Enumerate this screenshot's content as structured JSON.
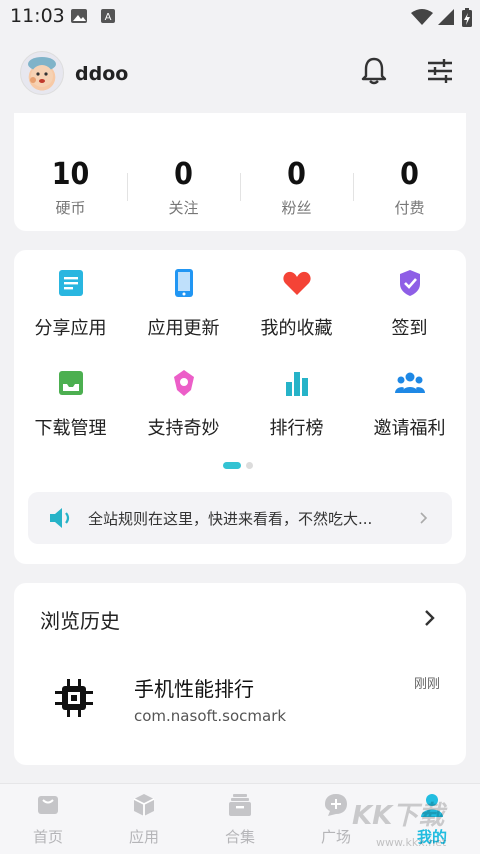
{
  "status": {
    "time": "11:03"
  },
  "profile": {
    "username": "ddoo"
  },
  "stats": [
    {
      "value": "10",
      "label": "硬币"
    },
    {
      "value": "0",
      "label": "关注"
    },
    {
      "value": "0",
      "label": "粉丝"
    },
    {
      "value": "0",
      "label": "付费"
    }
  ],
  "grid": [
    {
      "label": "分享应用",
      "icon": "share-doc-icon",
      "color": "#29b6e0"
    },
    {
      "label": "应用更新",
      "icon": "phone-update-icon",
      "color": "#2196f3"
    },
    {
      "label": "我的收藏",
      "icon": "heart-icon",
      "color": "#f44336"
    },
    {
      "label": "签到",
      "icon": "checkin-badge-icon",
      "color": "#8e5ee6"
    },
    {
      "label": "下载管理",
      "icon": "download-tray-icon",
      "color": "#4caf50"
    },
    {
      "label": "支持奇妙",
      "icon": "support-gem-icon",
      "color": "#ec5ec8"
    },
    {
      "label": "排行榜",
      "icon": "ranking-bars-icon",
      "color": "#26b3c8"
    },
    {
      "label": "邀请福利",
      "icon": "invite-people-icon",
      "color": "#1e88e5"
    }
  ],
  "notice": {
    "text": "全站规则在这里，快进来看看，不然吃大..."
  },
  "history": {
    "title": "浏览历史",
    "items": [
      {
        "name": "手机性能排行",
        "package": "com.nasoft.socmark",
        "time": "刚刚"
      }
    ]
  },
  "tabs": [
    {
      "label": "首页",
      "icon": "home-icon",
      "active": false
    },
    {
      "label": "应用",
      "icon": "apps-cube-icon",
      "active": false
    },
    {
      "label": "合集",
      "icon": "collection-icon",
      "active": false
    },
    {
      "label": "广场",
      "icon": "square-chat-icon",
      "active": false
    },
    {
      "label": "我的",
      "icon": "profile-icon",
      "active": true
    }
  ],
  "colors": {
    "accent": "#22bde0",
    "background": "#f2f2f4",
    "card": "#ffffff"
  },
  "watermark": {
    "text": "KK下载",
    "url": "www.kkx.net"
  }
}
